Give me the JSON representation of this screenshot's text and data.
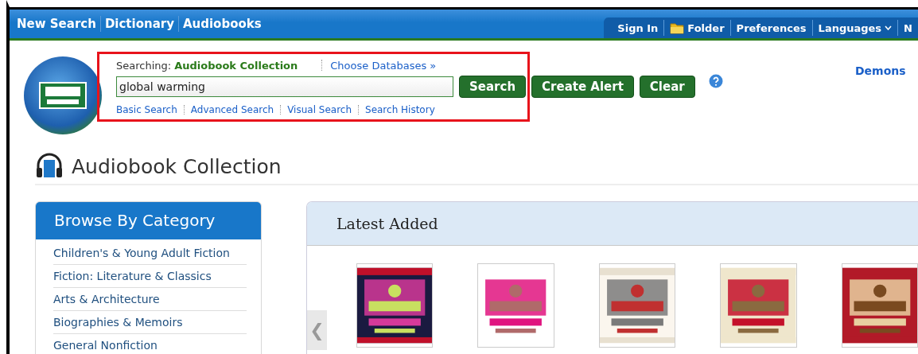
{
  "top_nav": {
    "left_links": [
      "New Search",
      "Dictionary",
      "Audiobooks"
    ],
    "right_links": [
      {
        "label": "Sign In",
        "kind": "link",
        "dropdown": false
      },
      {
        "label": "Folder",
        "kind": "folder",
        "dropdown": false
      },
      {
        "label": "Preferences",
        "kind": "link",
        "dropdown": false
      },
      {
        "label": "Languages",
        "kind": "link",
        "dropdown": true
      },
      {
        "label": "N",
        "kind": "link",
        "dropdown": false
      }
    ]
  },
  "search": {
    "searching_label": "Searching:",
    "database": "Audiobook Collection",
    "choose_link": "Choose Databases »",
    "query": "global warming",
    "buttons": [
      "Search",
      "Create Alert",
      "Clear"
    ],
    "links": [
      "Basic Search",
      "Advanced Search",
      "Visual Search",
      "Search History"
    ]
  },
  "demo_link": "Demons",
  "page_title": "Audiobook Collection",
  "browse": {
    "title": "Browse By Category",
    "categories": [
      "Children's & Young Adult Fiction",
      "Fiction: Literature & Classics",
      "Arts & Architecture",
      "Biographies & Memoirs",
      "General Nonfiction"
    ]
  },
  "latest": {
    "title": "Latest Added",
    "prev": "❮"
  }
}
